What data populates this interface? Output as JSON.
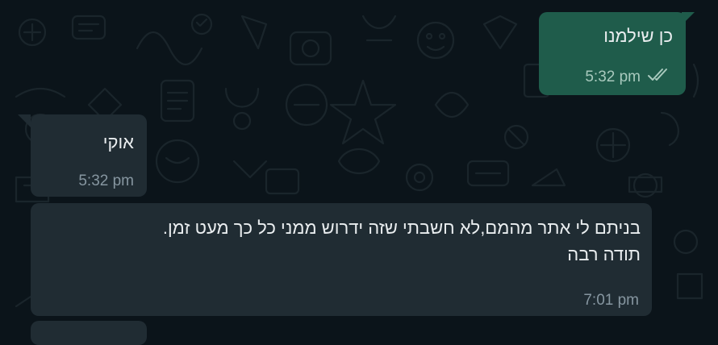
{
  "messages": [
    {
      "direction": "outgoing",
      "text": "כן שילמנו",
      "time": "5:32 pm",
      "status_icon": "double-check-icon"
    },
    {
      "direction": "incoming",
      "text": "אוקי",
      "time": "5:32 pm"
    },
    {
      "direction": "incoming",
      "text": "בניתם לי אתר מהמם,לא חשבתי שזה ידרוש ממני כל כך מעט זמן.\nתודה רבה",
      "time": "7:01 pm"
    }
  ],
  "colors": {
    "background": "#0b141a",
    "outgoing_bubble": "#1f5c4b",
    "incoming_bubble": "#202c33",
    "text": "#e9edef",
    "meta": "#8696a0"
  }
}
